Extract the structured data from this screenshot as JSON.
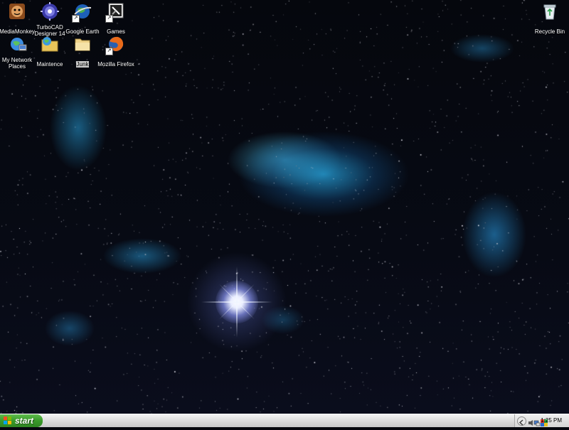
{
  "desktop": {
    "icons": [
      {
        "label": "MediaMonkey",
        "icon": "mediamonkey-icon",
        "shortcut": false,
        "selected": false
      },
      {
        "label": "TurboCAD Designer 14",
        "icon": "turbocad-icon",
        "shortcut": false,
        "selected": false
      },
      {
        "label": "Google Earth",
        "icon": "google-earth-icon",
        "shortcut": true,
        "selected": false
      },
      {
        "label": "Games",
        "icon": "games-icon",
        "shortcut": true,
        "selected": false
      },
      {
        "label": "My Network Places",
        "icon": "network-places-icon",
        "shortcut": false,
        "selected": false
      },
      {
        "label": "Maintence",
        "icon": "maintenance-folder-icon",
        "shortcut": false,
        "selected": false
      },
      {
        "label": "Junk",
        "icon": "folder-icon",
        "shortcut": false,
        "selected": true
      },
      {
        "label": "Mozilla Firefox",
        "icon": "firefox-icon",
        "shortcut": true,
        "selected": false
      },
      {
        "label": "Recycle Bin",
        "icon": "recycle-bin-icon",
        "shortcut": false,
        "selected": false
      }
    ]
  },
  "taskbar": {
    "start_label": "start",
    "clock": "1:25 PM",
    "tray_icons": [
      "expand-arrow-icon",
      "speaker-icon",
      "network-icon",
      "app-icon"
    ]
  },
  "colors": {
    "taskbar": "#d8d8d8",
    "start_green": "#3a9a2a",
    "desktop_bg": "#05070d",
    "nebula": "#28aae6"
  }
}
